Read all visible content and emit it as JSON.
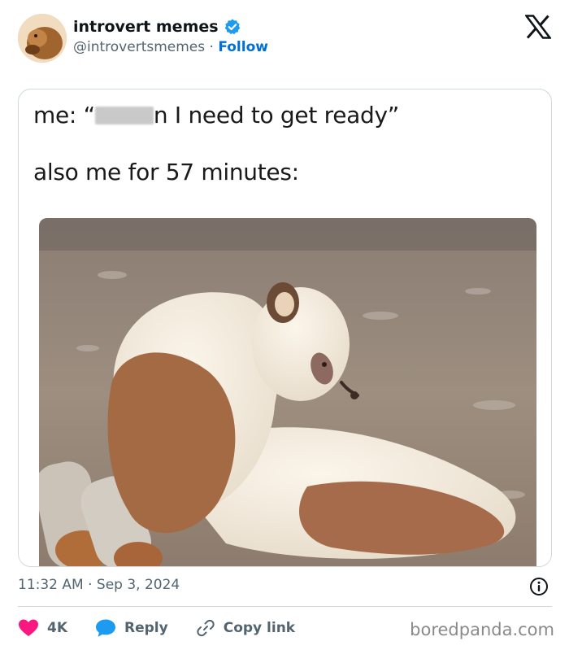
{
  "author": {
    "display_name": "introvert memes",
    "handle": "@introvertsmemes",
    "separator": "·",
    "follow_label": "Follow"
  },
  "tweet": {
    "caption_line1_before": "me: “",
    "caption_line1_after": "n I need to get ready”",
    "caption_line2": "also me for 57 minutes:",
    "timestamp": "11:32 AM · Sep 3, 2024"
  },
  "actions": {
    "like_count": "4K",
    "reply_label": "Reply",
    "copy_link_label": "Copy link"
  },
  "watermark": "boredpanda.com",
  "colors": {
    "accent": "#1d9bf0",
    "like": "#f91880",
    "muted": "#536471"
  },
  "icons": [
    "verified-badge-icon",
    "x-logo-icon",
    "info-icon",
    "heart-icon",
    "reply-bubble-icon",
    "link-icon"
  ]
}
